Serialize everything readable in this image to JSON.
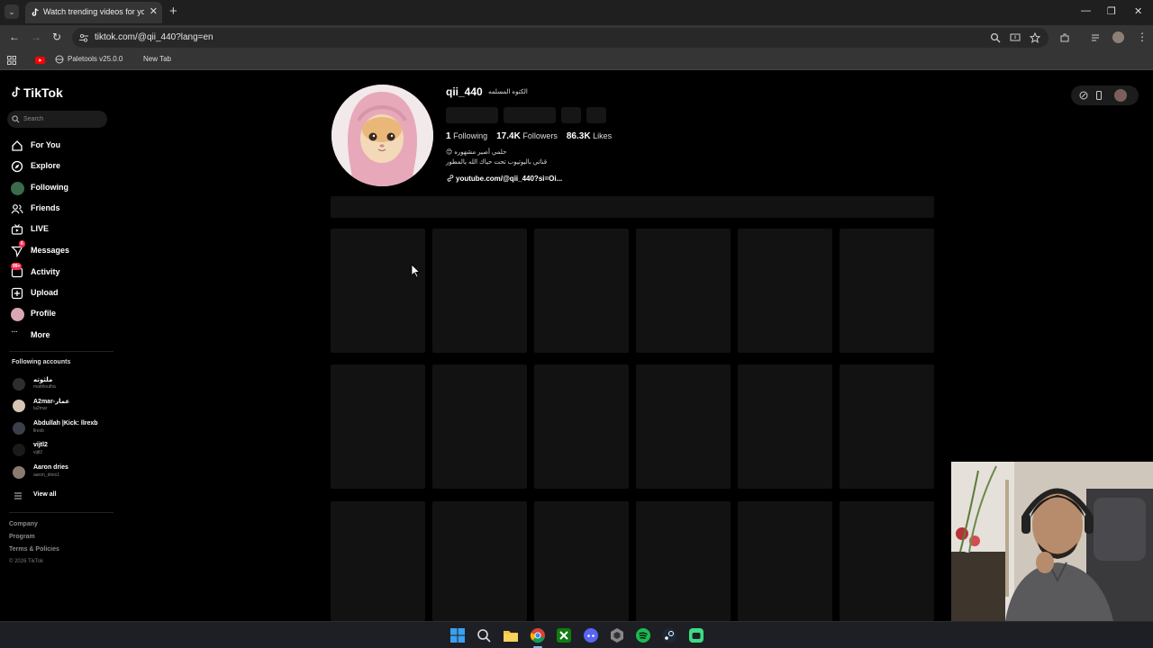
{
  "browser": {
    "tab_title": "Watch trending videos for you | TikTok",
    "url": "tiktok.com/@qii_440?lang=en",
    "bookmarks": [
      "Paletools v25.0.0",
      "New Tab"
    ]
  },
  "sidebar": {
    "logo": "TikTok",
    "search_placeholder": "Search",
    "nav": [
      {
        "label": "For You",
        "icon": "home-icon"
      },
      {
        "label": "Explore",
        "icon": "compass-icon"
      },
      {
        "label": "Following",
        "icon": "following-avatar-icon"
      },
      {
        "label": "Friends",
        "icon": "friends-icon"
      },
      {
        "label": "LIVE",
        "icon": "live-icon"
      },
      {
        "label": "Messages",
        "icon": "send-icon",
        "badge": "6"
      },
      {
        "label": "Activity",
        "icon": "activity-icon",
        "badge": "99+"
      },
      {
        "label": "Upload",
        "icon": "upload-icon"
      },
      {
        "label": "Profile",
        "icon": "profile-avatar-icon"
      },
      {
        "label": "More",
        "icon": "more-icon"
      }
    ],
    "following_title": "Following accounts",
    "accounts": [
      {
        "name": "ملثوته",
        "handle": "mathloutha"
      },
      {
        "name": "A2mar-عمار",
        "handle": "la2mar"
      },
      {
        "name": "Abdullah |Kick: llrexb",
        "handle": "llrexb"
      },
      {
        "name": "vijtl2",
        "handle": "vijtl2"
      },
      {
        "name": "Aaron dries",
        "handle": "aaron_dries1"
      }
    ],
    "view_all": "View all",
    "footer": [
      "Company",
      "Program",
      "Terms & Policies"
    ],
    "copyright": "© 2026 TikTok"
  },
  "profile": {
    "username": "qii_440",
    "nickname": "الكتوه المسلمه",
    "following_count": "1",
    "following_label": "Following",
    "followers_count": "17.4K",
    "followers_label": "Followers",
    "likes_count": "86.3K",
    "likes_label": "Likes",
    "bio_line1": "حلمي أصير مشهوره 😊",
    "bio_line2": "قناتي باليوتيوب تحت حياك الله يالمطور",
    "link": "youtube.com/@qii_440?si=Oi..."
  },
  "colors": {
    "background": "#000000",
    "skeleton": "#121212",
    "accent": "#fe2c55"
  }
}
